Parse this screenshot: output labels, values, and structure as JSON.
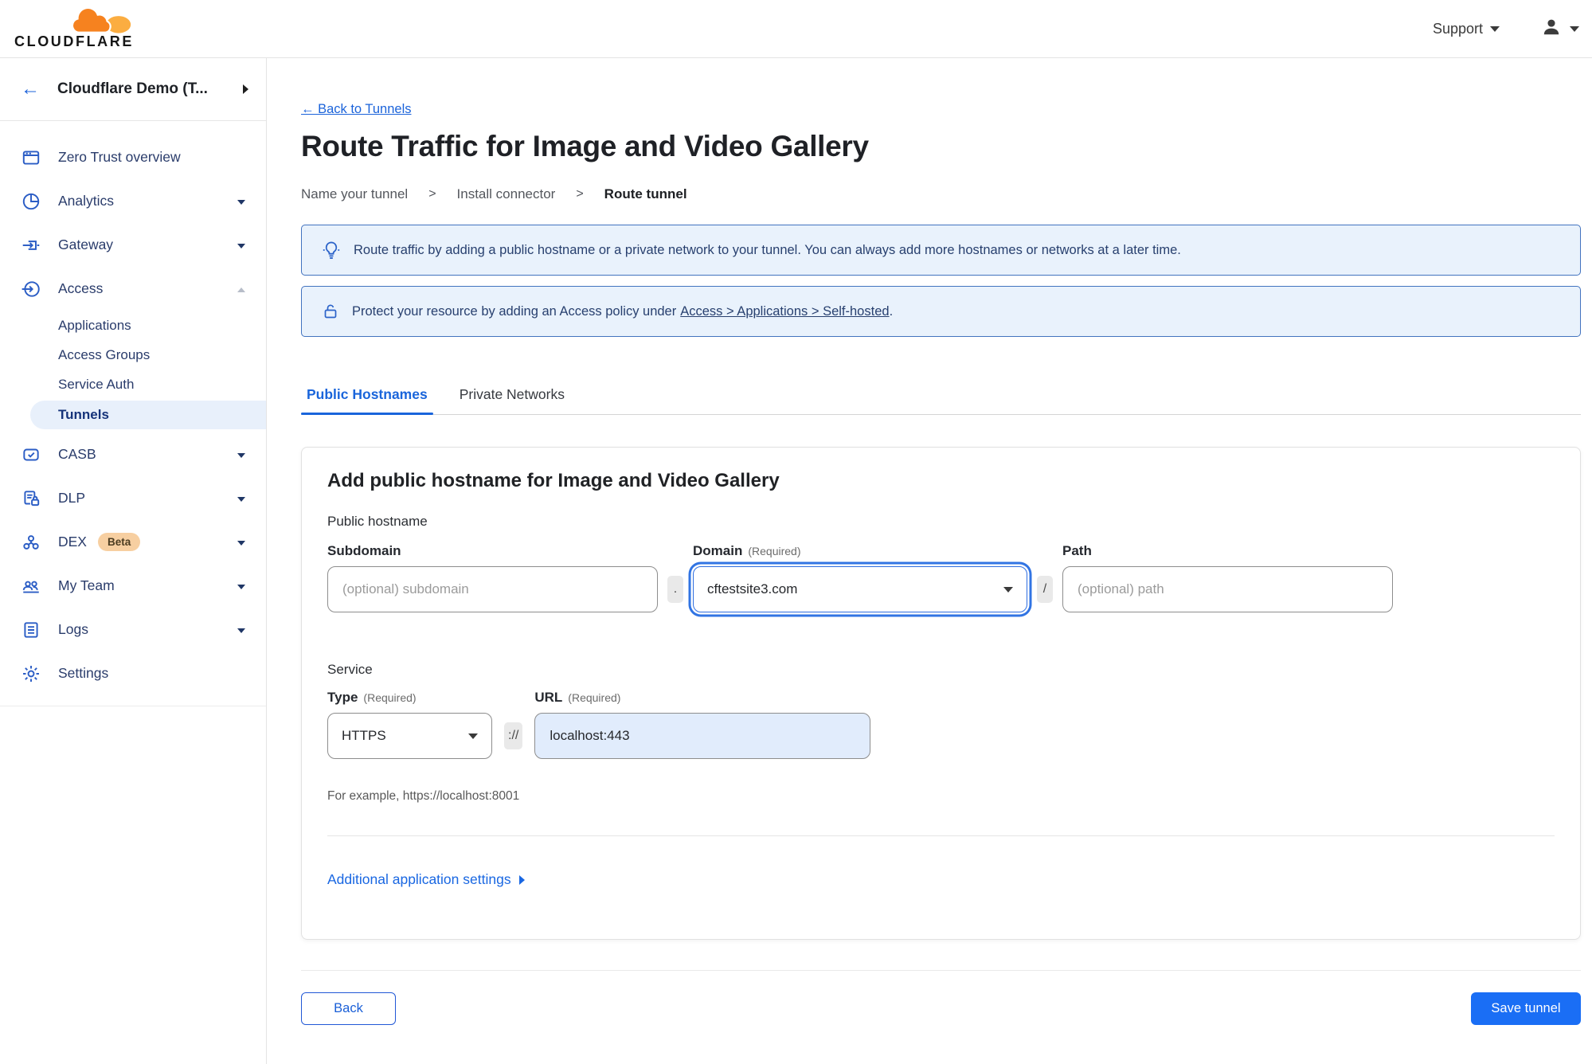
{
  "topbar": {
    "logo_text": "CLOUDFLARE",
    "support_label": "Support"
  },
  "sidebar": {
    "back_arrow": "←",
    "account_name": "Cloudflare Demo (T...",
    "overview": "Zero Trust overview",
    "analytics": "Analytics",
    "gateway": "Gateway",
    "access": "Access",
    "applications": "Applications",
    "access_groups": "Access Groups",
    "service_auth": "Service Auth",
    "tunnels": "Tunnels",
    "casb": "CASB",
    "dlp": "DLP",
    "dex": "DEX",
    "dex_badge": "Beta",
    "my_team": "My Team",
    "logs": "Logs",
    "settings": "Settings"
  },
  "header": {
    "back_link": "← Back to Tunnels",
    "title": "Route Traffic for Image and Video Gallery",
    "step1": "Name your tunnel",
    "step2": "Install connector",
    "step3": "Route tunnel",
    "separator": ">"
  },
  "banners": {
    "tip_text": "Route traffic by adding a public hostname or a private network to your tunnel. You can always add more hostnames or networks at a later time.",
    "policy_prefix": "Protect your resource by adding an Access policy under",
    "policy_link": "Access > Applications > Self-hosted",
    "policy_suffix": "."
  },
  "tabs": {
    "public_hostnames": "Public Hostnames",
    "private_networks": "Private Networks"
  },
  "form": {
    "card_title": "Add public hostname for Image and Video Gallery",
    "section_public_hostname": "Public hostname",
    "subdomain_label": "Subdomain",
    "subdomain_placeholder": "(optional) subdomain",
    "dot": ".",
    "domain_label": "Domain",
    "required": "(Required)",
    "domain_value": "cftestsite3.com",
    "slash": "/",
    "path_label": "Path",
    "path_placeholder": "(optional) path",
    "section_service": "Service",
    "type_label": "Type",
    "type_value": "HTTPS",
    "scheme": "://",
    "url_label": "URL",
    "url_value": "localhost:443",
    "example": "For example, https://localhost:8001",
    "additional_settings": "Additional application settings"
  },
  "footer": {
    "back": "Back",
    "save": "Save tunnel"
  },
  "colors": {
    "accent_blue": "#1a6ef5",
    "link_blue": "#1b63da",
    "banner_bg": "#e9f2fc",
    "banner_border": "#4273bf",
    "banner_text": "#28406f",
    "sidebar_text": "#2a3c6b",
    "sidebar_icon": "#2b5dc5",
    "active_pill_bg": "#e8f0fb",
    "beta_badge_bg": "#f7cfa1",
    "logo_orange": "#f6821f",
    "logo_light_orange": "#fbad41"
  }
}
